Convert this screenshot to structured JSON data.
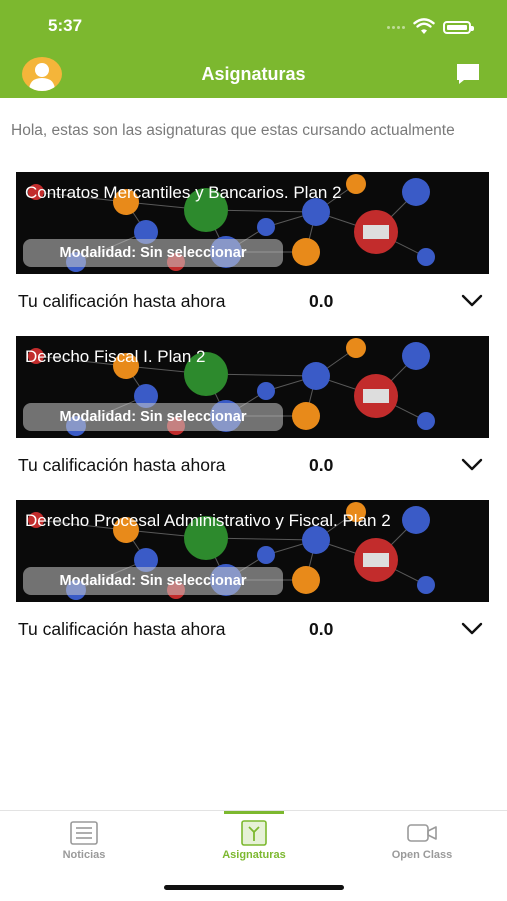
{
  "status": {
    "time": "5:37"
  },
  "header": {
    "title": "Asignaturas"
  },
  "intro": "Hola, estas son las asignaturas que estas cursando actualmente",
  "courses": [
    {
      "title": "Contratos Mercantiles y Bancarios. Plan 2",
      "modalidad": "Modalidad: Sin seleccionar",
      "grade_label": "Tu calificación hasta ahora",
      "grade": "0.0"
    },
    {
      "title": "Derecho Fiscal I. Plan 2",
      "modalidad": "Modalidad: Sin seleccionar",
      "grade_label": "Tu calificación hasta ahora",
      "grade": "0.0"
    },
    {
      "title": "Derecho Procesal Administrativo y Fiscal. Plan 2",
      "modalidad": "Modalidad: Sin seleccionar",
      "grade_label": "Tu calificación hasta ahora",
      "grade": "0.0"
    }
  ],
  "tabs": [
    {
      "label": "Noticias",
      "icon": "newspaper-icon",
      "active": false
    },
    {
      "label": "Asignaturas",
      "icon": "book-icon",
      "active": true
    },
    {
      "label": "Open Class",
      "icon": "video-camera-icon",
      "active": false
    }
  ],
  "colors": {
    "brand": "#7cb82f",
    "banner": "#0a0a0a",
    "muted_text": "#7a7a7a"
  }
}
